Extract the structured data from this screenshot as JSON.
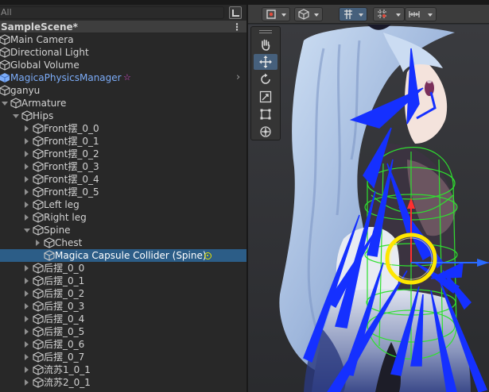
{
  "hierarchy": {
    "search_placeholder": "All",
    "scene_title": "SampleScene*",
    "menu_icon": "kebab-menu-icon",
    "rows": [
      {
        "label": "Main Camera",
        "indent": 0,
        "fold": "none",
        "style": "normal"
      },
      {
        "label": "Directional Light",
        "indent": 0,
        "fold": "none",
        "style": "normal"
      },
      {
        "label": "Global Volume",
        "indent": 0,
        "fold": "none",
        "style": "normal"
      },
      {
        "label": "MagicaPhysicsManager",
        "indent": 0,
        "fold": "none",
        "style": "prefab"
      },
      {
        "label": "ganyu",
        "indent": 0,
        "fold": "none",
        "style": "normal"
      },
      {
        "label": "Armature",
        "indent": 1,
        "fold": "open",
        "style": "normal"
      },
      {
        "label": "Hips",
        "indent": 2,
        "fold": "open",
        "style": "normal"
      },
      {
        "label": "Front摆_0_0",
        "indent": 3,
        "fold": "closed",
        "style": "normal"
      },
      {
        "label": "Front摆_0_1",
        "indent": 3,
        "fold": "closed",
        "style": "normal"
      },
      {
        "label": "Front摆_0_2",
        "indent": 3,
        "fold": "closed",
        "style": "normal"
      },
      {
        "label": "Front摆_0_3",
        "indent": 3,
        "fold": "closed",
        "style": "normal"
      },
      {
        "label": "Front摆_0_4",
        "indent": 3,
        "fold": "closed",
        "style": "normal"
      },
      {
        "label": "Front摆_0_5",
        "indent": 3,
        "fold": "closed",
        "style": "normal"
      },
      {
        "label": "Left leg",
        "indent": 3,
        "fold": "closed",
        "style": "normal"
      },
      {
        "label": "Right leg",
        "indent": 3,
        "fold": "closed",
        "style": "normal"
      },
      {
        "label": "Spine",
        "indent": 3,
        "fold": "open",
        "style": "normal"
      },
      {
        "label": "Chest",
        "indent": 4,
        "fold": "closed",
        "style": "normal"
      },
      {
        "label": "Magica Capsule Collider (Spine)",
        "indent": 4,
        "fold": "none",
        "style": "selected"
      },
      {
        "label": "后摆_0_0",
        "indent": 3,
        "fold": "closed",
        "style": "normal"
      },
      {
        "label": "后摆_0_1",
        "indent": 3,
        "fold": "closed",
        "style": "normal"
      },
      {
        "label": "后摆_0_2",
        "indent": 3,
        "fold": "closed",
        "style": "normal"
      },
      {
        "label": "后摆_0_3",
        "indent": 3,
        "fold": "closed",
        "style": "normal"
      },
      {
        "label": "后摆_0_4",
        "indent": 3,
        "fold": "closed",
        "style": "normal"
      },
      {
        "label": "后摆_0_5",
        "indent": 3,
        "fold": "closed",
        "style": "normal"
      },
      {
        "label": "后摆_0_6",
        "indent": 3,
        "fold": "closed",
        "style": "normal"
      },
      {
        "label": "后摆_0_7",
        "indent": 3,
        "fold": "closed",
        "style": "normal"
      },
      {
        "label": "流苏1_0_1",
        "indent": 3,
        "fold": "closed",
        "style": "normal"
      },
      {
        "label": "流苏2_0_1",
        "indent": 3,
        "fold": "closed",
        "style": "normal"
      }
    ]
  },
  "scene": {
    "tools": [
      "hand-tool-icon",
      "move-tool-icon",
      "rotate-tool-icon",
      "scale-tool-icon",
      "rect-tool-icon",
      "transform-tool-icon"
    ],
    "active_tool": "move-tool-icon"
  },
  "colors": {
    "selection": "#2c5d87",
    "prefab_text": "#7cacf8",
    "bone_blue": "#1530ff",
    "collider_green": "#2fe02f",
    "gizmo_yellow": "#ffe600"
  }
}
